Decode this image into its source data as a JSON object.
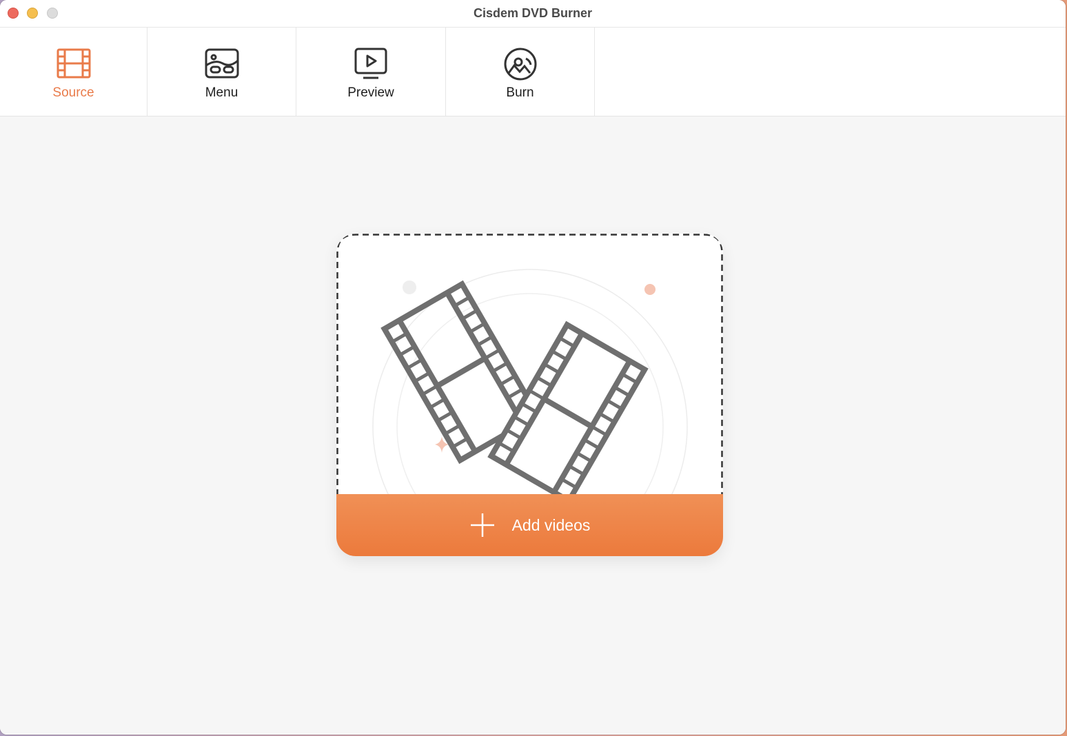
{
  "window": {
    "title": "Cisdem DVD Burner",
    "controls": [
      "close",
      "minimize",
      "zoom"
    ]
  },
  "toolbar": {
    "tabs": [
      {
        "id": "source",
        "label": "Source",
        "icon": "film-icon",
        "active": true
      },
      {
        "id": "menu",
        "label": "Menu",
        "icon": "menu-layout-icon",
        "active": false
      },
      {
        "id": "preview",
        "label": "Preview",
        "icon": "play-screen-icon",
        "active": false
      },
      {
        "id": "burn",
        "label": "Burn",
        "icon": "disc-burn-icon",
        "active": false
      }
    ]
  },
  "dropzone": {
    "illustration": "film-strips-icon",
    "add_label": "Add videos",
    "add_icon": "plus-icon"
  },
  "colors": {
    "accent": "#e97b4a",
    "button_top": "#f09056",
    "button_bottom": "#ec7a3c",
    "icon_gray": "#6f6f6f"
  }
}
